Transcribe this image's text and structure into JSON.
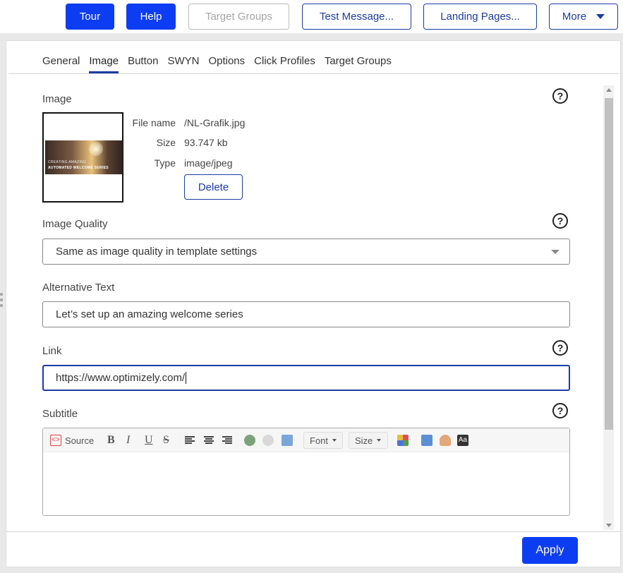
{
  "toolbar": {
    "tour": "Tour",
    "help": "Help",
    "target_groups": "Target Groups",
    "test_message": "Test Message...",
    "landing_pages": "Landing Pages...",
    "more": "More"
  },
  "tabs": [
    "General",
    "Image",
    "Button",
    "SWYN",
    "Options",
    "Click Profiles",
    "Target Groups"
  ],
  "image_section": {
    "label": "Image",
    "help": "?",
    "thumbnail_text_1": "CREATING AMAZING",
    "thumbnail_text_2": "AUTOMATED WELCOME SERIES",
    "file_name_label": "File name",
    "file_name": "/NL-Grafik.jpg",
    "size_label": "Size",
    "size": "93.747 kb",
    "type_label": "Type",
    "type": "image/jpeg",
    "delete": "Delete"
  },
  "image_quality": {
    "label": "Image Quality",
    "help": "?",
    "value": "Same as image quality in template settings"
  },
  "alt_text": {
    "label": "Alternative Text",
    "value": "Let’s set up an amazing welcome series"
  },
  "link": {
    "label": "Link",
    "help": "?",
    "value": "https://www.optimizely.com/"
  },
  "subtitle": {
    "label": "Subtitle",
    "help": "?",
    "source": "Source",
    "bold": "B",
    "italic": "I",
    "underline": "U",
    "strike": "S",
    "font": "Font",
    "size": "Size",
    "text_style": "Aa"
  },
  "footer": {
    "apply": "Apply"
  },
  "colors": {
    "primary": "#0d3df2",
    "outline": "#1b3ca6"
  }
}
